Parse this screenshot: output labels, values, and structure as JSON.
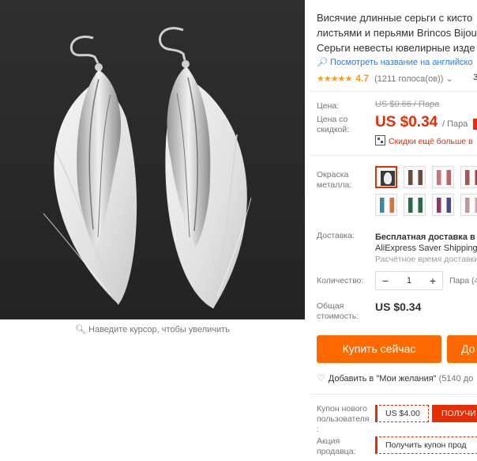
{
  "image": {
    "zoom_hint": "Наведите курсор, чтобы увеличить"
  },
  "product": {
    "title_lines": [
      "Висячие длинные серьги с кисто",
      "листьями и перьями Brincos Bijou",
      "Серьги невесты ювелирные изде"
    ],
    "translate_link": "Посмотреть название на английско",
    "rating_value": "4.7",
    "rating_count": "(1211 голоса(ов))",
    "rating_extra": "3"
  },
  "price": {
    "price_label": "Цена:",
    "old_price": "US $0.66 / Пара",
    "discount_label_1": "Цена со",
    "discount_label_2": "скидкой:",
    "new_price": "US $0.34",
    "unit": "/ Пара",
    "more_discounts": "Скидки ещё больше в"
  },
  "color": {
    "label_1": "Окраска",
    "label_2": "металла:"
  },
  "shipping": {
    "label": "Доставка:",
    "line1": "Бесплатная доставка в Р",
    "line2": "AliExpress Saver Shipping",
    "estimate": "Расчётное время доставки"
  },
  "quantity": {
    "label": "Количество:",
    "minus": "−",
    "value": "1",
    "plus": "+",
    "unit": "Пара (4"
  },
  "total": {
    "label_1": "Общая",
    "label_2": "стоимость:",
    "value": "US $0.34"
  },
  "actions": {
    "buy_now": "Купить сейчас",
    "add_to_cart": "До",
    "wishlist": "Добавить в \"Мои желания\"",
    "wishlist_count": "(5140 до"
  },
  "coupons": {
    "new_user_label_1": "Купон нового",
    "new_user_label_2": "пользователя",
    "new_user_label_3": ":",
    "new_user_value": "US $4.00",
    "new_user_get": "ПОЛУЧИ",
    "seller_label_1": "Акция",
    "seller_label_2": "продавца:",
    "seller_value": "Получить купон прод"
  },
  "colors": {
    "accent": "#e62e04",
    "button": "#ff6a00",
    "link": "#2b7bd6",
    "star": "#f0a020"
  }
}
